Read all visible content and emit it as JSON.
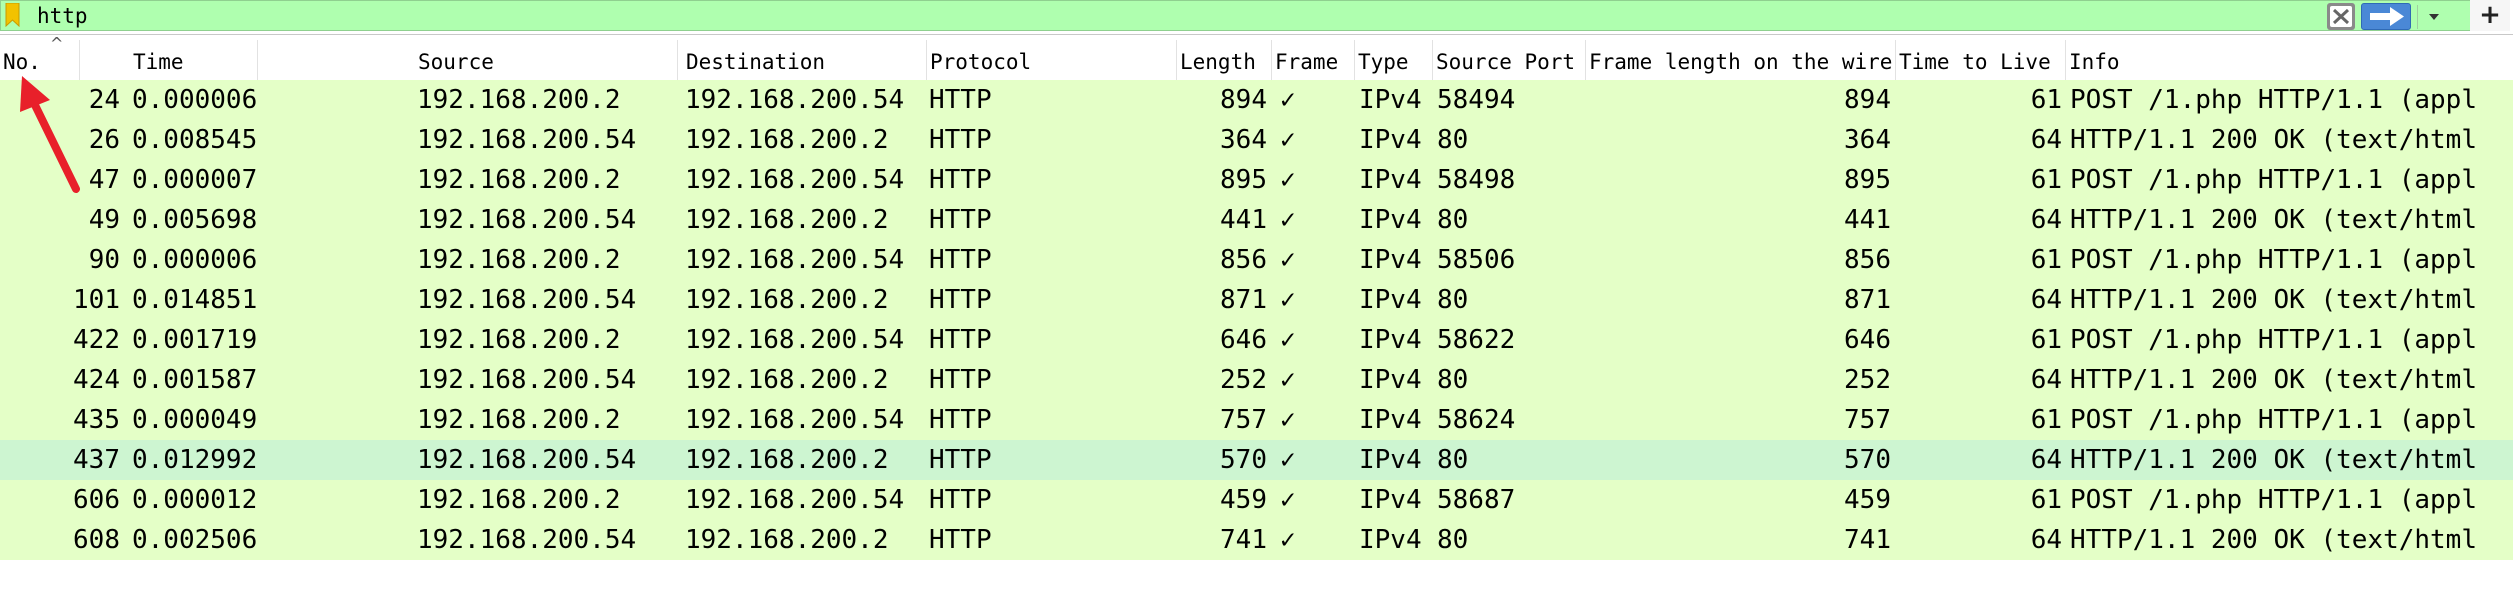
{
  "filter": {
    "value": "http"
  },
  "columns": [
    {
      "key": "no",
      "label": "No."
    },
    {
      "key": "time",
      "label": "Time"
    },
    {
      "key": "source",
      "label": "Source"
    },
    {
      "key": "destination",
      "label": "Destination"
    },
    {
      "key": "protocol",
      "label": "Protocol"
    },
    {
      "key": "length",
      "label": "Length"
    },
    {
      "key": "frame",
      "label": "Frame"
    },
    {
      "key": "type",
      "label": "Type"
    },
    {
      "key": "srcport",
      "label": "Source Port"
    },
    {
      "key": "wirelen",
      "label": "Frame length on the wire"
    },
    {
      "key": "ttl",
      "label": "Time to Live"
    },
    {
      "key": "info",
      "label": "Info"
    }
  ],
  "sort_indicator": "^",
  "rows": [
    {
      "no": "24",
      "time": "0.000006",
      "source": "192.168.200.2",
      "destination": "192.168.200.54",
      "protocol": "HTTP",
      "length": "894",
      "frame": "✓",
      "type": "IPv4",
      "srcport": "58494",
      "wirelen": "894",
      "ttl": "61",
      "info": "POST /1.php HTTP/1.1  (appl"
    },
    {
      "no": "26",
      "time": "0.008545",
      "source": "192.168.200.54",
      "destination": "192.168.200.2",
      "protocol": "HTTP",
      "length": "364",
      "frame": "✓",
      "type": "IPv4",
      "srcport": "80",
      "wirelen": "364",
      "ttl": "64",
      "info": "HTTP/1.1 200 OK  (text/html"
    },
    {
      "no": "47",
      "time": "0.000007",
      "source": "192.168.200.2",
      "destination": "192.168.200.54",
      "protocol": "HTTP",
      "length": "895",
      "frame": "✓",
      "type": "IPv4",
      "srcport": "58498",
      "wirelen": "895",
      "ttl": "61",
      "info": "POST /1.php HTTP/1.1  (appl"
    },
    {
      "no": "49",
      "time": "0.005698",
      "source": "192.168.200.54",
      "destination": "192.168.200.2",
      "protocol": "HTTP",
      "length": "441",
      "frame": "✓",
      "type": "IPv4",
      "srcport": "80",
      "wirelen": "441",
      "ttl": "64",
      "info": "HTTP/1.1 200 OK  (text/html"
    },
    {
      "no": "90",
      "time": "0.000006",
      "source": "192.168.200.2",
      "destination": "192.168.200.54",
      "protocol": "HTTP",
      "length": "856",
      "frame": "✓",
      "type": "IPv4",
      "srcport": "58506",
      "wirelen": "856",
      "ttl": "61",
      "info": "POST /1.php HTTP/1.1  (appl"
    },
    {
      "no": "101",
      "time": "0.014851",
      "source": "192.168.200.54",
      "destination": "192.168.200.2",
      "protocol": "HTTP",
      "length": "871",
      "frame": "✓",
      "type": "IPv4",
      "srcport": "80",
      "wirelen": "871",
      "ttl": "64",
      "info": "HTTP/1.1 200 OK  (text/html"
    },
    {
      "no": "422",
      "time": "0.001719",
      "source": "192.168.200.2",
      "destination": "192.168.200.54",
      "protocol": "HTTP",
      "length": "646",
      "frame": "✓",
      "type": "IPv4",
      "srcport": "58622",
      "wirelen": "646",
      "ttl": "61",
      "info": "POST /1.php HTTP/1.1  (appl"
    },
    {
      "no": "424",
      "time": "0.001587",
      "source": "192.168.200.54",
      "destination": "192.168.200.2",
      "protocol": "HTTP",
      "length": "252",
      "frame": "✓",
      "type": "IPv4",
      "srcport": "80",
      "wirelen": "252",
      "ttl": "64",
      "info": "HTTP/1.1 200 OK  (text/html"
    },
    {
      "no": "435",
      "time": "0.000049",
      "source": "192.168.200.2",
      "destination": "192.168.200.54",
      "protocol": "HTTP",
      "length": "757",
      "frame": "✓",
      "type": "IPv4",
      "srcport": "58624",
      "wirelen": "757",
      "ttl": "61",
      "info": "POST /1.php HTTP/1.1  (appl"
    },
    {
      "no": "437",
      "time": "0.012992",
      "source": "192.168.200.54",
      "destination": "192.168.200.2",
      "protocol": "HTTP",
      "length": "570",
      "frame": "✓",
      "type": "IPv4",
      "srcport": "80",
      "wirelen": "570",
      "ttl": "64",
      "info": "HTTP/1.1 200 OK  (text/html",
      "selected": true
    },
    {
      "no": "606",
      "time": "0.000012",
      "source": "192.168.200.2",
      "destination": "192.168.200.54",
      "protocol": "HTTP",
      "length": "459",
      "frame": "✓",
      "type": "IPv4",
      "srcport": "58687",
      "wirelen": "459",
      "ttl": "61",
      "info": "POST /1.php HTTP/1.1  (appl"
    },
    {
      "no": "608",
      "time": "0.002506",
      "source": "192.168.200.54",
      "destination": "192.168.200.2",
      "protocol": "HTTP",
      "length": "741",
      "frame": "✓",
      "type": "IPv4",
      "srcport": "80",
      "wirelen": "741",
      "ttl": "64",
      "info": "HTTP/1.1 200 OK  (text/html"
    }
  ],
  "colors": {
    "filter_valid": "#afffaf",
    "row_http": "#e4ffc7",
    "row_selected": "#cdf5d1",
    "apply_button": "#4a88d6",
    "annotation_arrow": "#e8202a"
  },
  "icons": {
    "bookmark": "bookmark-icon",
    "clear": "clear-icon",
    "apply": "arrow-right-icon",
    "dropdown": "chevron-down-icon",
    "add": "plus-icon"
  }
}
